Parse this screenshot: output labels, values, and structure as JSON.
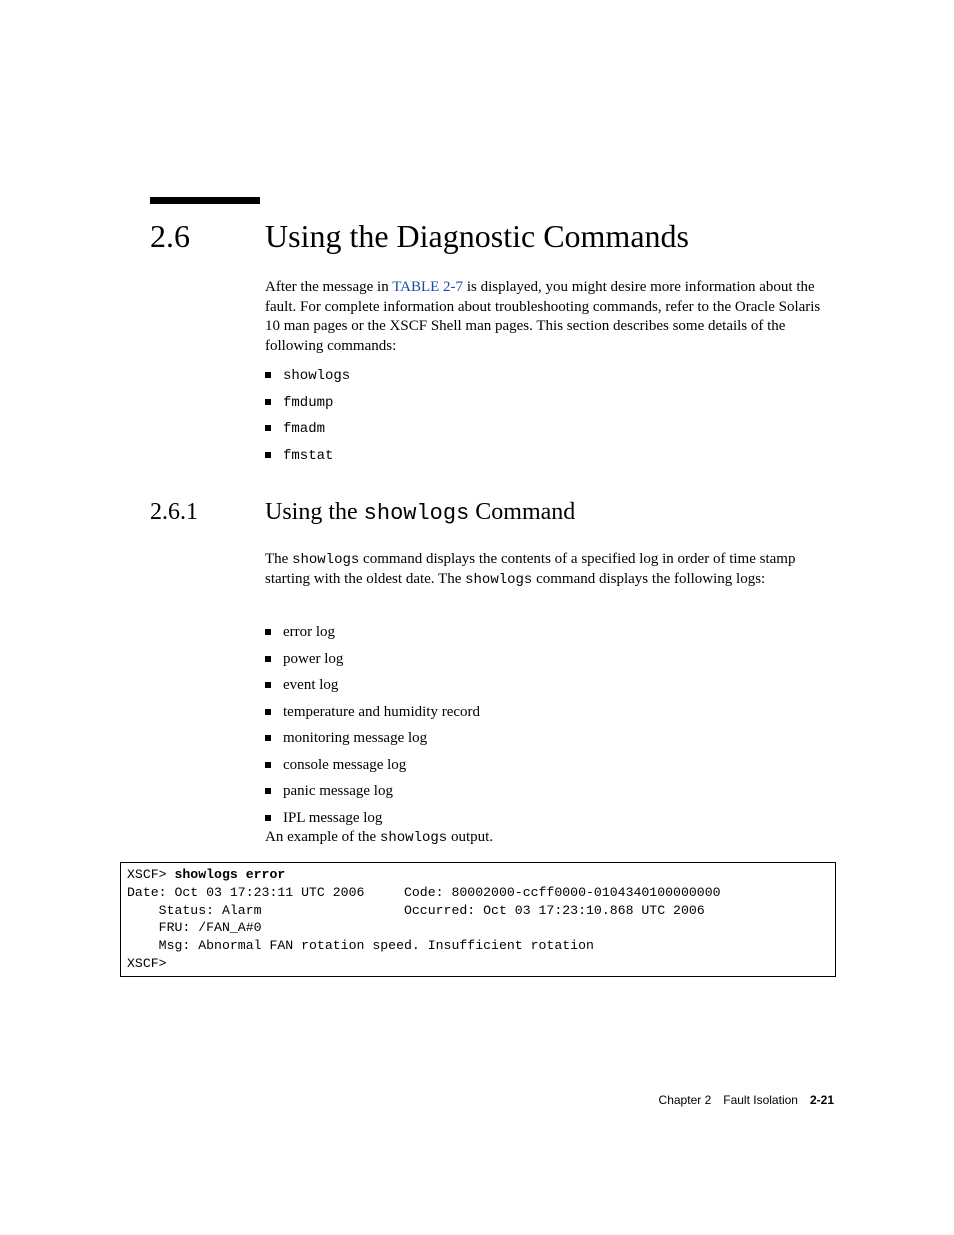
{
  "section": {
    "number": "2.6",
    "title": "Using the Diagnostic Commands"
  },
  "intro": {
    "before_link": "After the message in ",
    "link_text": "TABLE 2-7",
    "after_link": " is displayed, you might desire more information about the fault. For complete information about troubleshooting commands, refer to the Oracle Solaris 10 man pages or the XSCF Shell man pages. This section describes some details of the following commands:"
  },
  "commands": [
    "showlogs",
    "fmdump",
    "fmadm",
    "fmstat"
  ],
  "subsection": {
    "number": "2.6.1",
    "title_prefix": "Using the ",
    "title_cmd": "showlogs",
    "title_suffix": " Command"
  },
  "showlogs_para": {
    "t1": "The ",
    "cmd1": "showlogs",
    "t2": " command displays the contents of a specified log in order of time stamp starting with the oldest date. The ",
    "cmd2": "showlogs",
    "t3": " command displays the following logs:"
  },
  "logs": [
    "error log",
    "power log",
    "event log",
    "temperature and humidity record",
    "monitoring message log",
    "console message log",
    "panic message log",
    "IPL message log"
  ],
  "example_para": {
    "t1": "An example of the ",
    "cmd": "showlogs",
    "t2": " output."
  },
  "code": {
    "prompt1": "XSCF> ",
    "bold_cmd": "showlogs error",
    "line2": "Date: Oct 03 17:23:11 UTC 2006     Code: 80002000-ccff0000-0104340100000000",
    "line3": "    Status: Alarm                  Occurred: Oct 03 17:23:10.868 UTC 2006",
    "line4": "    FRU: /FAN_A#0",
    "line5": "    Msg: Abnormal FAN rotation speed. Insufficient rotation",
    "line6": "XSCF>"
  },
  "footer": {
    "chapter": "Chapter 2",
    "title": "Fault Isolation",
    "page": "2-21"
  }
}
